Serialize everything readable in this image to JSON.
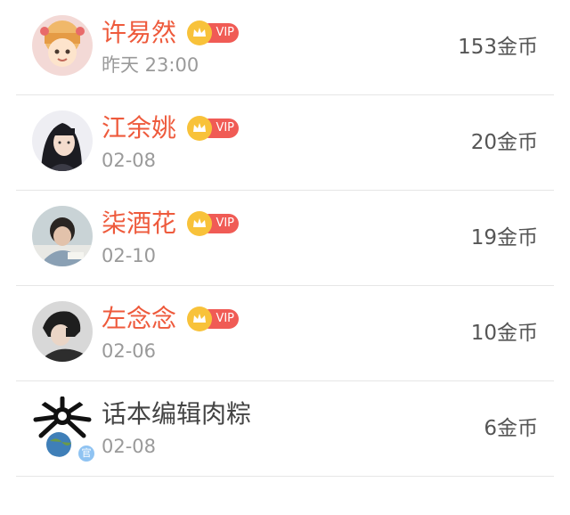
{
  "rows": [
    {
      "name": "许易然",
      "vip": true,
      "vip_label": "VIP",
      "date": "昨天 23:00",
      "coins": "153金币"
    },
    {
      "name": "江余姚",
      "vip": true,
      "vip_label": "VIP",
      "date": "02-08",
      "coins": "20金币"
    },
    {
      "name": "柒酒花",
      "vip": true,
      "vip_label": "VIP",
      "date": "02-10",
      "coins": "19金币"
    },
    {
      "name": "左念念",
      "vip": true,
      "vip_label": "VIP",
      "date": "02-06",
      "coins": "10金币"
    },
    {
      "name": "话本编辑肉粽",
      "vip": false,
      "date": "02-08",
      "coins": "6金币"
    }
  ],
  "colors": {
    "vip_name": "#ee5a3c",
    "normal_name": "#444444",
    "vip_pill": "#f05b55",
    "crown": "#f8c23a"
  }
}
